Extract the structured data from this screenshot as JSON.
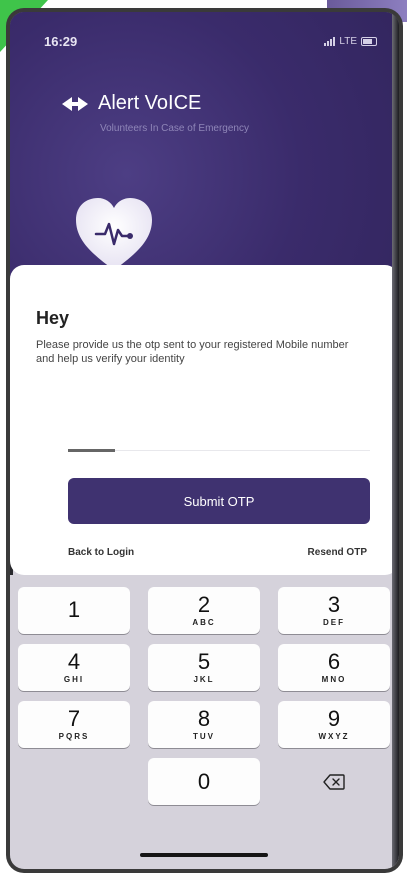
{
  "status_bar": {
    "time": "16:29",
    "network": "LTE"
  },
  "brand": {
    "name": "Alert VoICE",
    "tagline": "Volunteers In Case of Emergency",
    "logo_icon": "alert-voice-logo-icon",
    "hero_icon": "heart-pulse-icon"
  },
  "otp_form": {
    "title": "Hey",
    "description": "Please provide us the otp sent to your registered Mobile number and help us verify your identity",
    "otp_value": "",
    "submit_label": "Submit OTP",
    "back_label": "Back to Login",
    "resend_label": "Resend OTP"
  },
  "keypad": {
    "keys": [
      {
        "digit": "1",
        "letters": ""
      },
      {
        "digit": "2",
        "letters": "ABC"
      },
      {
        "digit": "3",
        "letters": "DEF"
      },
      {
        "digit": "4",
        "letters": "GHI"
      },
      {
        "digit": "5",
        "letters": "JKL"
      },
      {
        "digit": "6",
        "letters": "MNO"
      },
      {
        "digit": "7",
        "letters": "PQRS"
      },
      {
        "digit": "8",
        "letters": "TUV"
      },
      {
        "digit": "9",
        "letters": "WXYZ"
      },
      {
        "digit": "0",
        "letters": ""
      }
    ],
    "delete_icon": "backspace-icon"
  },
  "colors": {
    "brand_purple": "#3f3270",
    "header_purple": "#3a2b6b",
    "keypad_background": "#d5d2db"
  }
}
